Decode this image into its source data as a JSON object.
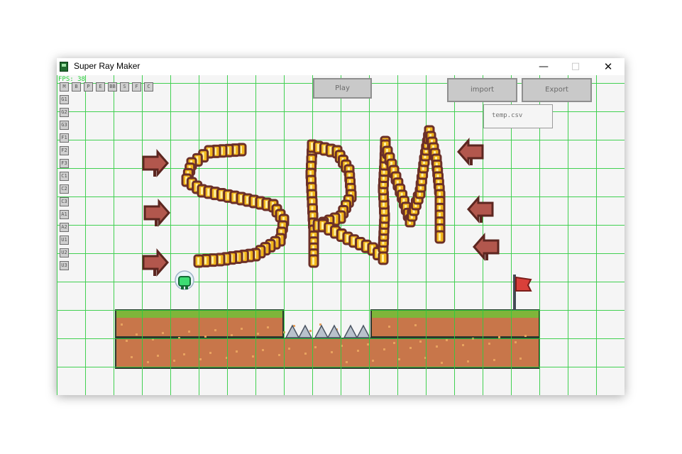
{
  "window": {
    "title": "Super Ray Maker",
    "minimize_icon": "minimize-icon",
    "maximize_icon": "maximize-icon",
    "close_icon": "close-icon"
  },
  "editor": {
    "fps_label": "FPS: 38",
    "top_tools": [
      "M",
      "B",
      "P",
      "E",
      "BB",
      "S",
      "F",
      "C"
    ],
    "side_tools": [
      "G1",
      "G2",
      "G3",
      "F1",
      "F2",
      "F3",
      "C1",
      "C2",
      "C3",
      "A1",
      "A2",
      "U1",
      "U2",
      "U3"
    ],
    "play_label": "Play",
    "import_label": "import",
    "export_label": "Export",
    "file_name": "temp.csv"
  },
  "colors": {
    "grid": "#2ecc40",
    "grass": "#7fb53a",
    "dirt": "#c8764a",
    "coin": "#f2b61b",
    "coin_outline": "#6b2f28",
    "flag": "#d9403a"
  }
}
